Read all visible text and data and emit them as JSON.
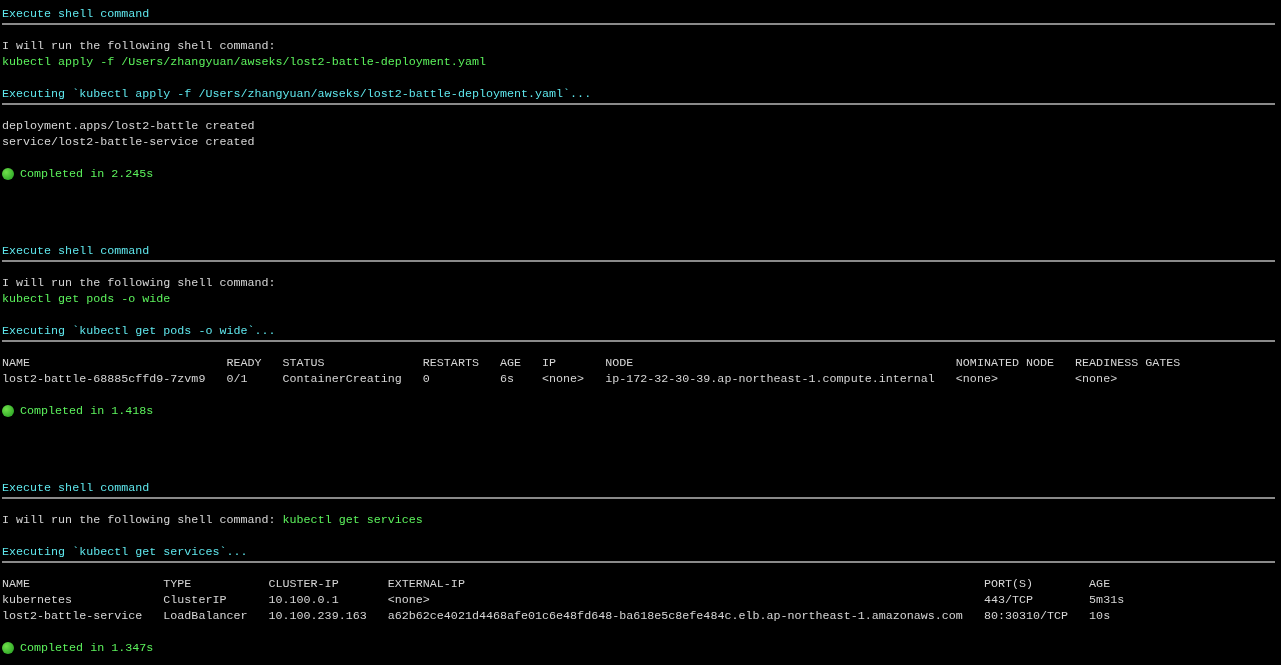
{
  "blocks": [
    {
      "title": "Execute shell command",
      "intro": "I will run the following shell command:",
      "command": "kubectl apply -f /Users/zhangyuan/awseks/lost2-battle-deployment.yaml",
      "inline_command": false,
      "executing": "Executing `kubectl apply -f /Users/zhangyuan/awseks/lost2-battle-deployment.yaml`...",
      "output": {
        "kind": "lines",
        "lines": [
          "deployment.apps/lost2-battle created",
          "service/lost2-battle-service created"
        ]
      },
      "completed": "Completed in 2.245s"
    },
    {
      "title": "Execute shell command",
      "intro": "I will run the following shell command:",
      "command": "kubectl get pods -o wide",
      "inline_command": false,
      "executing": "Executing `kubectl get pods -o wide`...",
      "output": {
        "kind": "table",
        "columns": [
          "NAME",
          "READY",
          "STATUS",
          "RESTARTS",
          "AGE",
          "IP",
          "NODE",
          "NOMINATED NODE",
          "READINESS GATES"
        ],
        "rows": [
          [
            "lost2-battle-68885cffd9-7zvm9",
            "0/1",
            "ContainerCreating",
            "0",
            "6s",
            "<none>",
            "ip-172-32-30-39.ap-northeast-1.compute.internal",
            "<none>",
            "<none>"
          ]
        ]
      },
      "completed": "Completed in 1.418s"
    },
    {
      "title": "Execute shell command",
      "intro": "I will run the following shell command:",
      "command": "kubectl get services",
      "inline_command": true,
      "executing": "Executing `kubectl get services`...",
      "output": {
        "kind": "table",
        "columns": [
          "NAME",
          "TYPE",
          "CLUSTER-IP",
          "EXTERNAL-IP",
          "PORT(S)",
          "AGE"
        ],
        "rows": [
          [
            "kubernetes",
            "ClusterIP",
            "10.100.0.1",
            "<none>",
            "443/TCP",
            "5m31s"
          ],
          [
            "lost2-battle-service",
            "LoadBalancer",
            "10.100.239.163",
            "a62b62ce4021d4468afe01c6e48fd648-ba618e5c8efe484c.elb.ap-northeast-1.amazonaws.com",
            "80:30310/TCP",
            "10s"
          ]
        ]
      },
      "completed": "Completed in 1.347s"
    }
  ]
}
